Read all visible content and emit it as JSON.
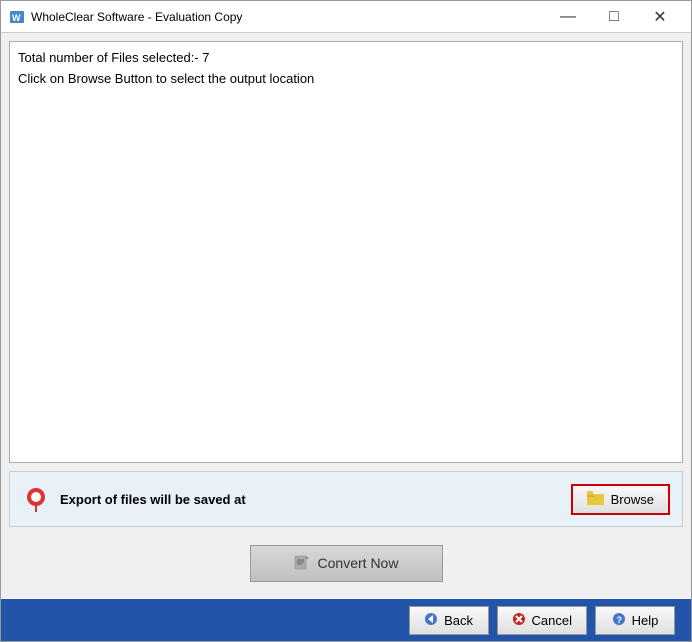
{
  "window": {
    "title": "WholeClear Software - Evaluation Copy"
  },
  "titlebar": {
    "minimize_label": "—",
    "maximize_label": "□",
    "close_label": "✕"
  },
  "main": {
    "info_line1": "Total number of Files selected:- 7",
    "info_line2": "Click on Browse Button to select the output location"
  },
  "browse_bar": {
    "label": "Export of files will be saved at",
    "button_label": "Browse"
  },
  "convert": {
    "button_label": "Convert Now"
  },
  "bottom": {
    "back_label": "Back",
    "cancel_label": "Cancel",
    "help_label": "Help"
  }
}
